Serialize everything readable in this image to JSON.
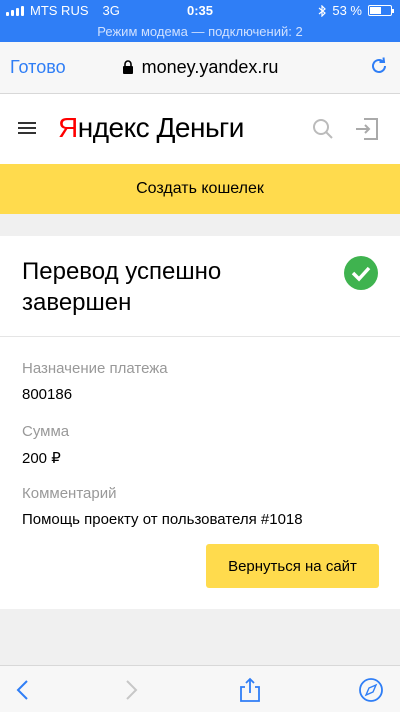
{
  "status_bar": {
    "carrier": "MTS RUS",
    "network": "3G",
    "time": "0:35",
    "battery": "53 %",
    "battery_level": 0.53
  },
  "hotspot_banner": "Режим модема — подключений: 2",
  "browser": {
    "done_label": "Готово",
    "url": "money.yandex.ru"
  },
  "header": {
    "logo_first": "Я",
    "logo_rest": "ндекс Деньги"
  },
  "create_wallet": "Создать кошелек",
  "result": {
    "title": "Перевод успешно завершен",
    "fields": [
      {
        "label": "Назначение платежа",
        "value": "800186"
      },
      {
        "label": "Сумма",
        "value": "200 ₽"
      },
      {
        "label": "Комментарий",
        "value": "Помощь проекту от пользователя #1018"
      }
    ],
    "back_button": "Вернуться на сайт"
  },
  "colors": {
    "accent_blue": "#2f7ef6",
    "yandex_yellow": "#ffdb4d",
    "success_green": "#3fb34f",
    "logo_red": "#ff0000"
  }
}
